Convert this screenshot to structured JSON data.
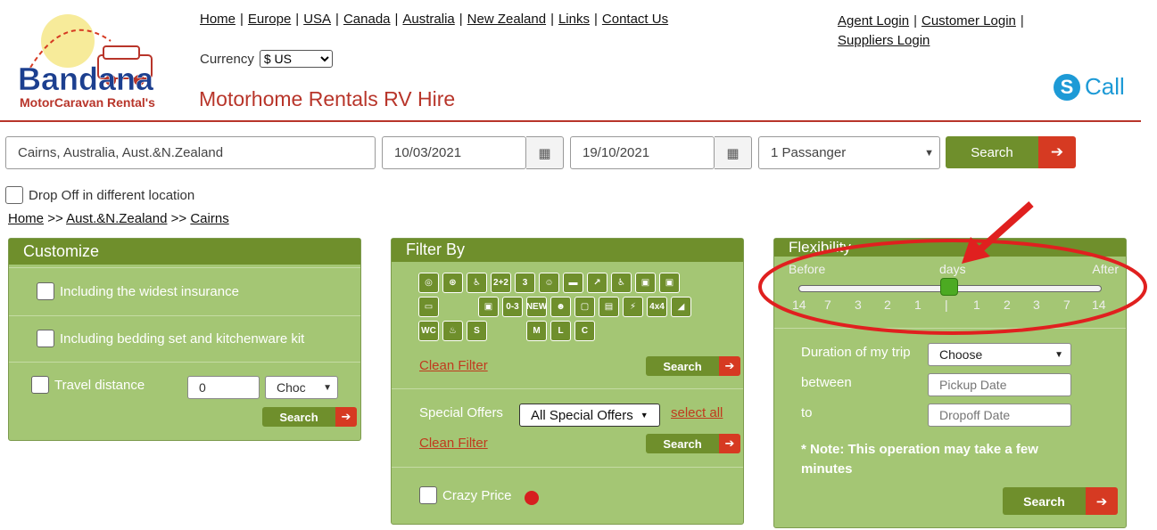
{
  "header": {
    "logo_text_main": "Bandana",
    "logo_text_sub": "MotorCaravan Rental's",
    "nav": [
      "Home",
      "Europe",
      "USA",
      "Canada",
      "Australia",
      "New Zealand",
      "Links",
      "Contact Us"
    ],
    "currency_label": "Currency",
    "currency_value": "$ US",
    "site_title": "Motorhome Rentals RV Hire",
    "agent_links": [
      "Agent Login",
      "Customer Login",
      "Suppliers Login"
    ],
    "skype_label": "Call"
  },
  "search": {
    "location": "Cairns, Australia, Aust.&N.Zealand",
    "pickup_date": "10/03/2021",
    "dropoff_date": "19/10/2021",
    "passengers": "1 Passanger",
    "button": "Search",
    "dropoff_different": "Drop Off in different location"
  },
  "breadcrumb": {
    "home": "Home",
    "region": "Aust.&N.Zealand",
    "city": "Cairns",
    "sep": ">>"
  },
  "customize": {
    "title": "Customize",
    "opt_insurance": "Including the widest insurance",
    "opt_bedding": "Including bedding set and kitchenware kit",
    "opt_distance": "Travel distance",
    "distance_value": "0",
    "distance_unit": "Choc",
    "search": "Search"
  },
  "filter": {
    "title": "Filter By",
    "amenity_icons": [
      "gps-icon",
      "steering-icon",
      "driver-icon",
      "2-2-seat-icon",
      "3-seat-icon",
      "family-icon",
      "bed-icon",
      "awning-icon",
      "wheelchair-icon",
      "rv-1-icon",
      "rv-2-icon",
      "rv-3-icon",
      "rv-4-icon",
      "rv-0-3-icon",
      "new-icon",
      "group-icon",
      "tv-icon",
      "solar-icon",
      "power-icon",
      "4x4-icon",
      "trailer-icon",
      "wc-icon",
      "shower-icon",
      "rv-s-icon",
      "rv-m-icon",
      "rv-l-icon",
      "rv-c-icon"
    ],
    "amenity_glyphs": [
      "◎",
      "⊛",
      "♿",
      "2+2",
      "3",
      "☺",
      "▬",
      "↗",
      "♿",
      "▣",
      "▣",
      "▭",
      "▣",
      "0-3",
      "NEW",
      "☻",
      "▢",
      "▤",
      "⚡",
      "4x4",
      "◢",
      "WC",
      "♨",
      "S",
      "M",
      "L",
      "C"
    ],
    "clean_filter": "Clean Filter",
    "search": "Search",
    "special_offers_label": "Special Offers",
    "special_offers_value": "All Special Offers",
    "select_all": "select all",
    "clean_filter_2": "Clean Filter",
    "crazy_price": "Crazy Price"
  },
  "flexibility": {
    "title": "Flexibility",
    "before": "Before",
    "days": "days",
    "after": "After",
    "ticks": [
      "14",
      "7",
      "3",
      "2",
      "1",
      "|",
      "1",
      "2",
      "3",
      "7",
      "14"
    ],
    "duration_label": "Duration of my trip",
    "duration_value": "Choose",
    "between_label": "between",
    "pickup_placeholder": "Pickup Date",
    "to_label": "to",
    "dropoff_placeholder": "Dropoff Date",
    "note": "* Note: This operation may take a few minutes",
    "search": "Search"
  },
  "colors": {
    "accent_green": "#6f8f2c",
    "panel_green": "#a4c674",
    "accent_red": "#d63a22",
    "title_red": "#b8352a"
  }
}
